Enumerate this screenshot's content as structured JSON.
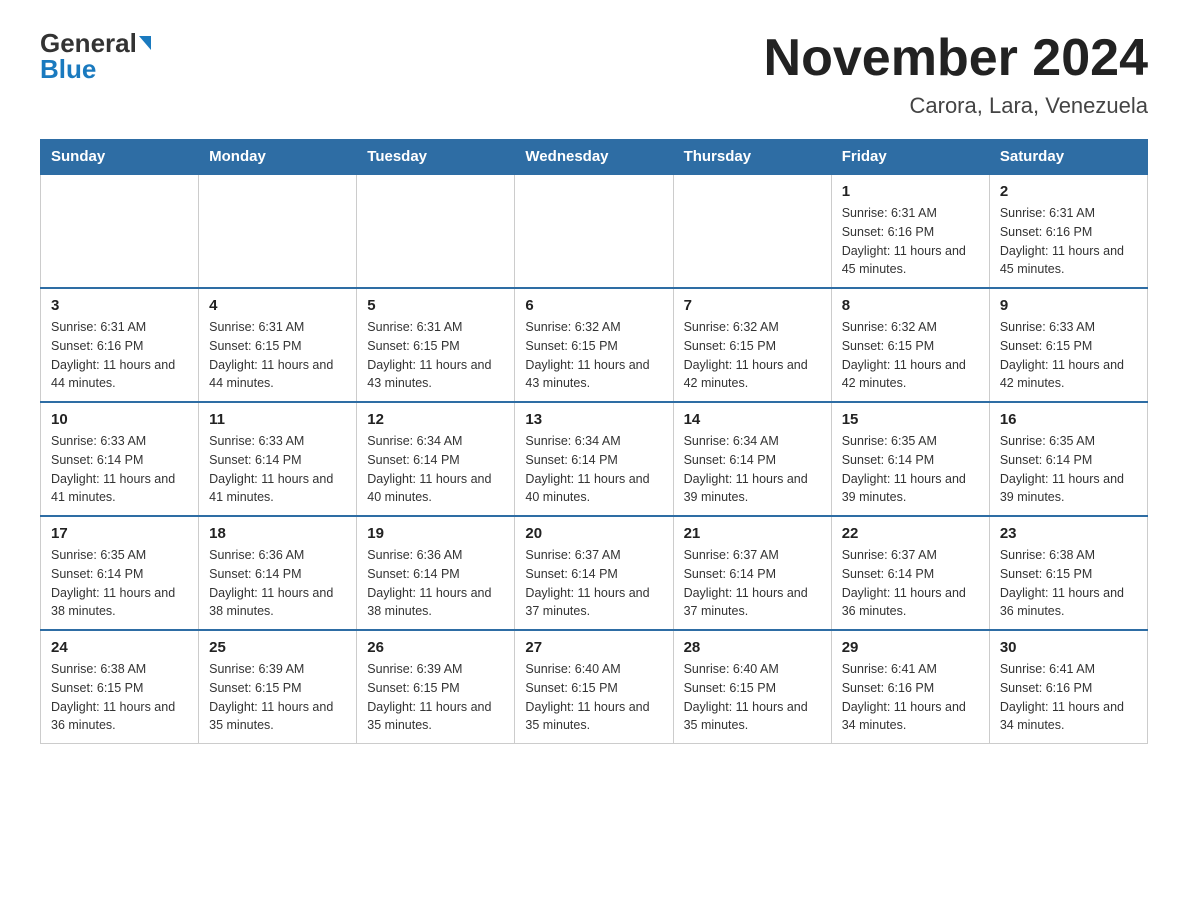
{
  "header": {
    "logo_general": "General",
    "logo_blue": "Blue",
    "month_title": "November 2024",
    "location": "Carora, Lara, Venezuela"
  },
  "days_of_week": [
    "Sunday",
    "Monday",
    "Tuesday",
    "Wednesday",
    "Thursday",
    "Friday",
    "Saturday"
  ],
  "weeks": [
    [
      {
        "day": "",
        "info": ""
      },
      {
        "day": "",
        "info": ""
      },
      {
        "day": "",
        "info": ""
      },
      {
        "day": "",
        "info": ""
      },
      {
        "day": "",
        "info": ""
      },
      {
        "day": "1",
        "info": "Sunrise: 6:31 AM\nSunset: 6:16 PM\nDaylight: 11 hours and 45 minutes."
      },
      {
        "day": "2",
        "info": "Sunrise: 6:31 AM\nSunset: 6:16 PM\nDaylight: 11 hours and 45 minutes."
      }
    ],
    [
      {
        "day": "3",
        "info": "Sunrise: 6:31 AM\nSunset: 6:16 PM\nDaylight: 11 hours and 44 minutes."
      },
      {
        "day": "4",
        "info": "Sunrise: 6:31 AM\nSunset: 6:15 PM\nDaylight: 11 hours and 44 minutes."
      },
      {
        "day": "5",
        "info": "Sunrise: 6:31 AM\nSunset: 6:15 PM\nDaylight: 11 hours and 43 minutes."
      },
      {
        "day": "6",
        "info": "Sunrise: 6:32 AM\nSunset: 6:15 PM\nDaylight: 11 hours and 43 minutes."
      },
      {
        "day": "7",
        "info": "Sunrise: 6:32 AM\nSunset: 6:15 PM\nDaylight: 11 hours and 42 minutes."
      },
      {
        "day": "8",
        "info": "Sunrise: 6:32 AM\nSunset: 6:15 PM\nDaylight: 11 hours and 42 minutes."
      },
      {
        "day": "9",
        "info": "Sunrise: 6:33 AM\nSunset: 6:15 PM\nDaylight: 11 hours and 42 minutes."
      }
    ],
    [
      {
        "day": "10",
        "info": "Sunrise: 6:33 AM\nSunset: 6:14 PM\nDaylight: 11 hours and 41 minutes."
      },
      {
        "day": "11",
        "info": "Sunrise: 6:33 AM\nSunset: 6:14 PM\nDaylight: 11 hours and 41 minutes."
      },
      {
        "day": "12",
        "info": "Sunrise: 6:34 AM\nSunset: 6:14 PM\nDaylight: 11 hours and 40 minutes."
      },
      {
        "day": "13",
        "info": "Sunrise: 6:34 AM\nSunset: 6:14 PM\nDaylight: 11 hours and 40 minutes."
      },
      {
        "day": "14",
        "info": "Sunrise: 6:34 AM\nSunset: 6:14 PM\nDaylight: 11 hours and 39 minutes."
      },
      {
        "day": "15",
        "info": "Sunrise: 6:35 AM\nSunset: 6:14 PM\nDaylight: 11 hours and 39 minutes."
      },
      {
        "day": "16",
        "info": "Sunrise: 6:35 AM\nSunset: 6:14 PM\nDaylight: 11 hours and 39 minutes."
      }
    ],
    [
      {
        "day": "17",
        "info": "Sunrise: 6:35 AM\nSunset: 6:14 PM\nDaylight: 11 hours and 38 minutes."
      },
      {
        "day": "18",
        "info": "Sunrise: 6:36 AM\nSunset: 6:14 PM\nDaylight: 11 hours and 38 minutes."
      },
      {
        "day": "19",
        "info": "Sunrise: 6:36 AM\nSunset: 6:14 PM\nDaylight: 11 hours and 38 minutes."
      },
      {
        "day": "20",
        "info": "Sunrise: 6:37 AM\nSunset: 6:14 PM\nDaylight: 11 hours and 37 minutes."
      },
      {
        "day": "21",
        "info": "Sunrise: 6:37 AM\nSunset: 6:14 PM\nDaylight: 11 hours and 37 minutes."
      },
      {
        "day": "22",
        "info": "Sunrise: 6:37 AM\nSunset: 6:14 PM\nDaylight: 11 hours and 36 minutes."
      },
      {
        "day": "23",
        "info": "Sunrise: 6:38 AM\nSunset: 6:15 PM\nDaylight: 11 hours and 36 minutes."
      }
    ],
    [
      {
        "day": "24",
        "info": "Sunrise: 6:38 AM\nSunset: 6:15 PM\nDaylight: 11 hours and 36 minutes."
      },
      {
        "day": "25",
        "info": "Sunrise: 6:39 AM\nSunset: 6:15 PM\nDaylight: 11 hours and 35 minutes."
      },
      {
        "day": "26",
        "info": "Sunrise: 6:39 AM\nSunset: 6:15 PM\nDaylight: 11 hours and 35 minutes."
      },
      {
        "day": "27",
        "info": "Sunrise: 6:40 AM\nSunset: 6:15 PM\nDaylight: 11 hours and 35 minutes."
      },
      {
        "day": "28",
        "info": "Sunrise: 6:40 AM\nSunset: 6:15 PM\nDaylight: 11 hours and 35 minutes."
      },
      {
        "day": "29",
        "info": "Sunrise: 6:41 AM\nSunset: 6:16 PM\nDaylight: 11 hours and 34 minutes."
      },
      {
        "day": "30",
        "info": "Sunrise: 6:41 AM\nSunset: 6:16 PM\nDaylight: 11 hours and 34 minutes."
      }
    ]
  ]
}
